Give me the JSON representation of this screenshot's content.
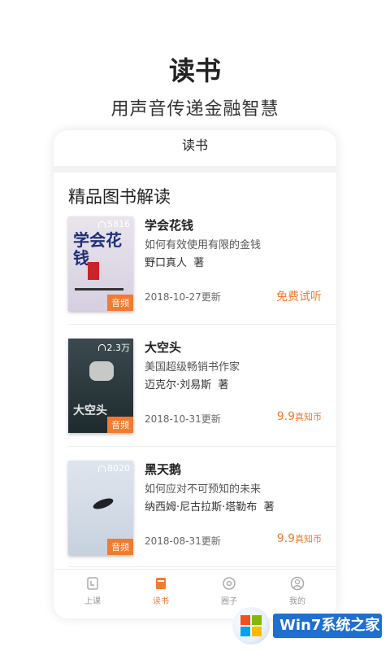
{
  "hero": {
    "title": "读书",
    "subtitle": "用声音传递金融智慧"
  },
  "app": {
    "title": "读书"
  },
  "section": {
    "title": "精品图书解读"
  },
  "books": [
    {
      "title": "学会花钱",
      "desc": "如何有效使用有限的金钱",
      "author": "野口真人",
      "author_suffix": "著",
      "date": "2018-10-27更新",
      "price": "免费试听",
      "unit": "",
      "plays": "5816",
      "tag": "音频",
      "cover_text": "学会花钱"
    },
    {
      "title": "大空头",
      "desc": "美国超级畅销书作家",
      "author": "迈克尔·刘易斯",
      "author_suffix": "著",
      "date": "2018-10-31更新",
      "price": "9.9",
      "unit": "真知币",
      "plays": "2.3万",
      "tag": "音频",
      "cover_text": "大空头"
    },
    {
      "title": "黑天鹅",
      "desc": "如何应对不可预知的未来",
      "author": "纳西姆·尼古拉斯·塔勒布",
      "author_suffix": "著",
      "date": "2018-08-31更新",
      "price": "9.9",
      "unit": "真知币",
      "plays": "8020",
      "tag": "音频",
      "cover_text": ""
    }
  ],
  "tabs": [
    {
      "label": "上课",
      "icon": "book-icon"
    },
    {
      "label": "读书",
      "icon": "reading-icon"
    },
    {
      "label": "圈子",
      "icon": "circle-icon"
    },
    {
      "label": "我的",
      "icon": "user-icon"
    }
  ],
  "watermark": {
    "text": "Win7系统之家"
  },
  "colors": {
    "accent": "#f37a2e",
    "muted": "#999999"
  }
}
